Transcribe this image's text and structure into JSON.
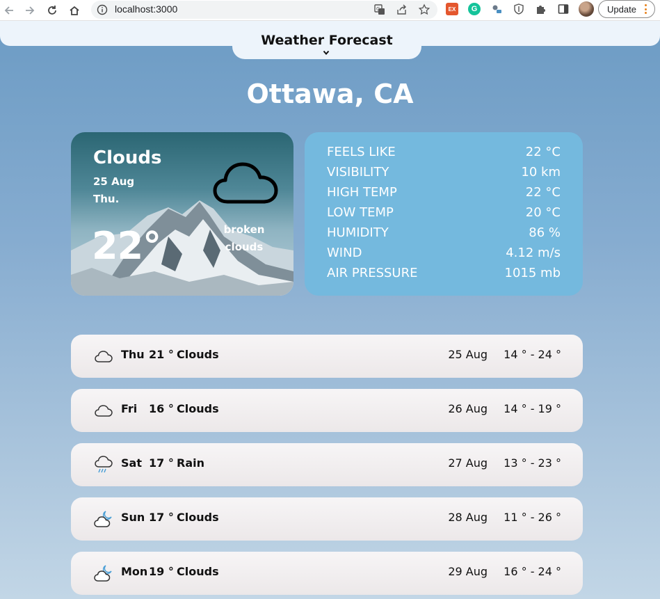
{
  "browser": {
    "url": "localhost:3000",
    "update_label": "Update"
  },
  "header": {
    "title": "Weather Forecast"
  },
  "city": "Ottawa, CA",
  "current": {
    "main": "Clouds",
    "date": "25 Aug",
    "day": "Thu.",
    "temp": "22°",
    "description_line1": "broken",
    "description_line2": "clouds",
    "icon": "cloud-icon"
  },
  "details": [
    {
      "label": "FEELS LIKE",
      "value": "22 °C"
    },
    {
      "label": "VISIBILITY",
      "value": "10 km"
    },
    {
      "label": "HIGH TEMP",
      "value": "22 °C"
    },
    {
      "label": "LOW TEMP",
      "value": "20 °C"
    },
    {
      "label": "HUMIDITY",
      "value": "86 %"
    },
    {
      "label": "WIND",
      "value": "4.12 m/s"
    },
    {
      "label": "AIR PRESSURE",
      "value": "1015 mb"
    }
  ],
  "forecast": [
    {
      "day": "Thu",
      "temp": "21 °",
      "main": "Clouds",
      "date": "25 Aug",
      "range": "14 ° - 24 °",
      "icon": "cloud-icon"
    },
    {
      "day": "Fri",
      "temp": "16 °",
      "main": "Clouds",
      "date": "26 Aug",
      "range": "14 ° - 19 °",
      "icon": "cloud-icon"
    },
    {
      "day": "Sat",
      "temp": "17 °",
      "main": "Rain",
      "date": "27 Aug",
      "range": "13 ° - 23 °",
      "icon": "rain-cloud-icon"
    },
    {
      "day": "Sun",
      "temp": "17 °",
      "main": "Clouds",
      "date": "28 Aug",
      "range": "11 ° - 26 °",
      "icon": "cloud-moon-icon"
    },
    {
      "day": "Mon",
      "temp": "19 °",
      "main": "Clouds",
      "date": "29 Aug",
      "range": "16 ° - 24 °",
      "icon": "cloud-moon-icon"
    }
  ],
  "colors": {
    "details_card": "#74b9de",
    "rain_accent": "#4a9fd6",
    "background_top": "#6a9ac3",
    "background_bottom": "#c2d6e6"
  }
}
